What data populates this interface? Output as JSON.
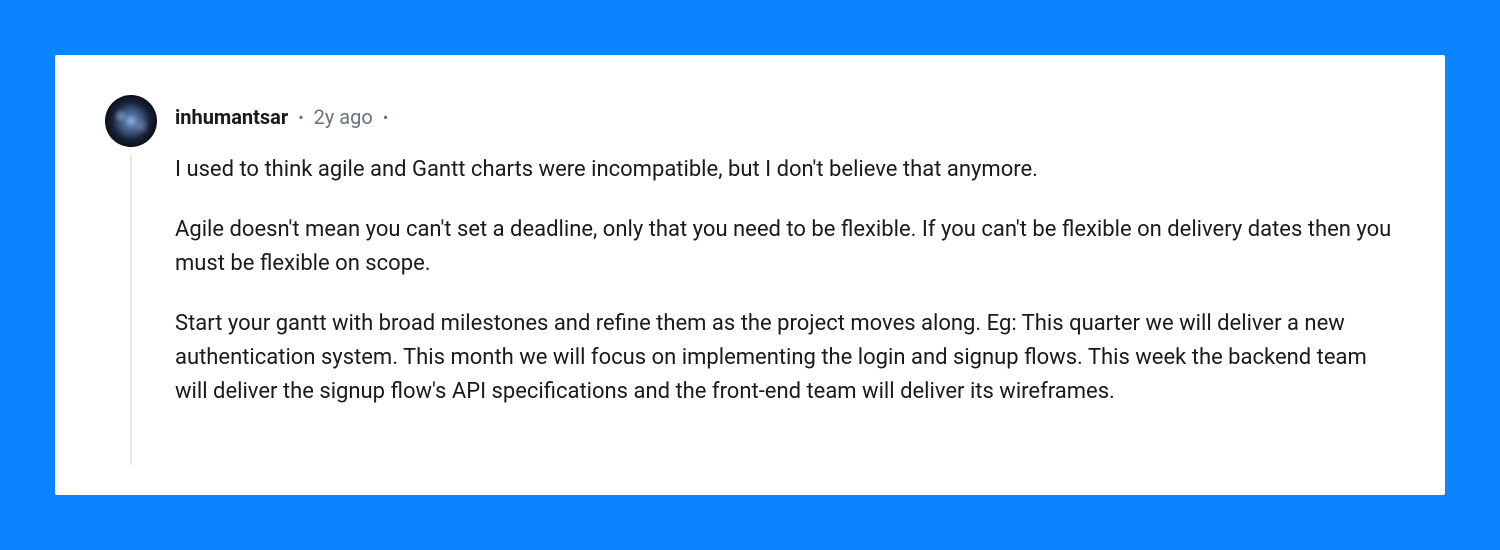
{
  "comment": {
    "username": "inhumantsar",
    "timestamp": "2y ago",
    "paragraphs": [
      "I used to think agile and Gantt charts were incompatible, but I don't believe that anymore.",
      "Agile doesn't mean you can't set a deadline, only that you need to be flexible. If you can't be flexible on delivery dates then you must be flexible on scope.",
      "Start your gantt with broad milestones and refine them as the project moves along. Eg: This quarter we will deliver a new authentication system. This month we will focus on implementing the login and signup flows. This week the backend team will deliver the signup flow's API specifications and the front-end team will deliver its wireframes."
    ]
  }
}
